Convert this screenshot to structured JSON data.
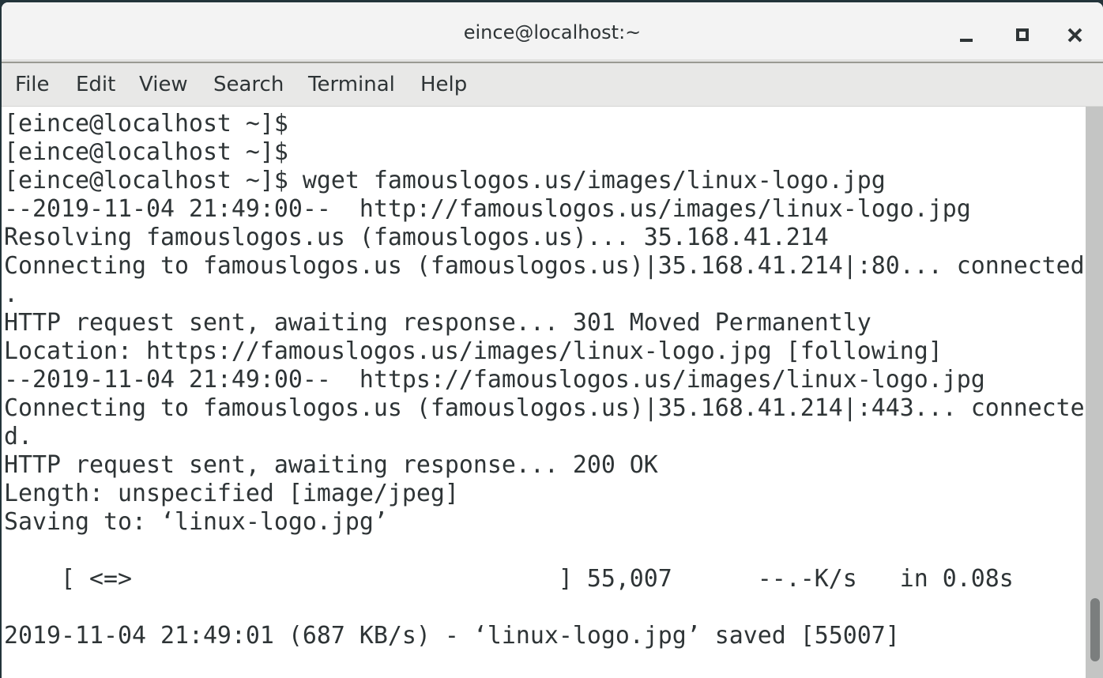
{
  "window": {
    "title": "eince@localhost:~"
  },
  "menu": [
    "File",
    "Edit",
    "View",
    "Search",
    "Terminal",
    "Help"
  ],
  "terminal": {
    "lines": [
      "[eince@localhost ~]$",
      "[eince@localhost ~]$",
      "[eince@localhost ~]$ wget famouslogos.us/images/linux-logo.jpg",
      "--2019-11-04 21:49:00--  http://famouslogos.us/images/linux-logo.jpg",
      "Resolving famouslogos.us (famouslogos.us)... 35.168.41.214",
      "Connecting to famouslogos.us (famouslogos.us)|35.168.41.214|:80... connected",
      ".",
      "HTTP request sent, awaiting response... 301 Moved Permanently",
      "Location: https://famouslogos.us/images/linux-logo.jpg [following]",
      "--2019-11-04 21:49:00--  https://famouslogos.us/images/linux-logo.jpg",
      "Connecting to famouslogos.us (famouslogos.us)|35.168.41.214|:443... connecte",
      "d.",
      "HTTP request sent, awaiting response... 200 OK",
      "Length: unspecified [image/jpeg]",
      "Saving to: ‘linux-logo.jpg’",
      "",
      "    [ <=>                              ] 55,007      --.-K/s   in 0.08s",
      "",
      "2019-11-04 21:49:01 (687 KB/s) - ‘linux-logo.jpg’ saved [55007]"
    ]
  },
  "scrollbar": {
    "position": 1.0
  }
}
